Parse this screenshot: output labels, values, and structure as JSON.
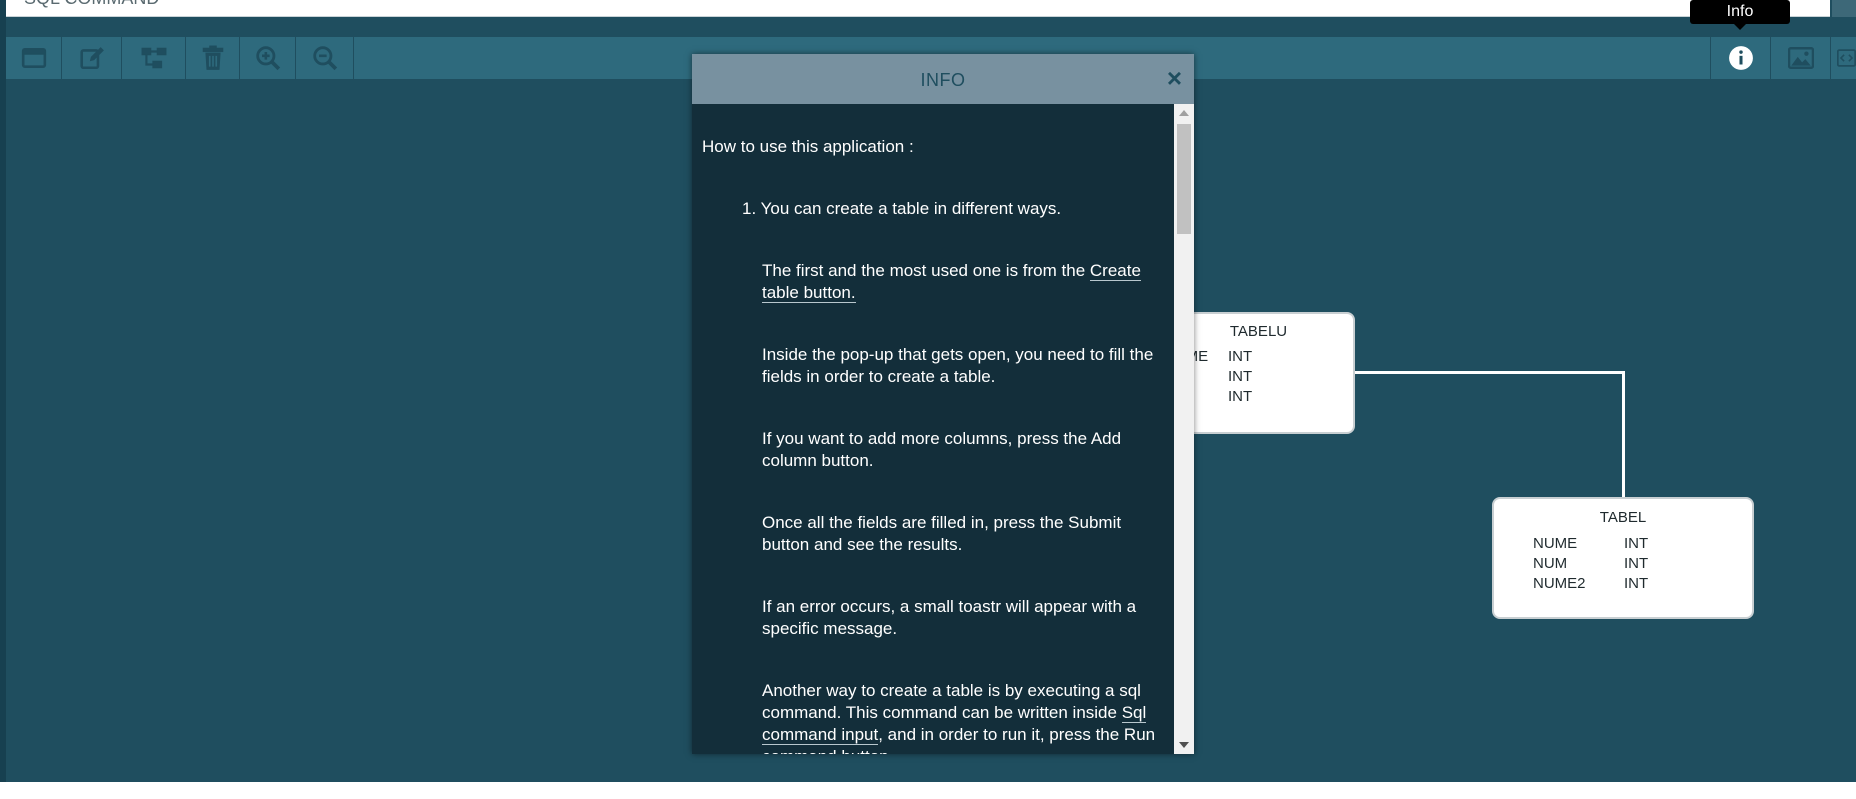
{
  "header": {
    "sql_input_text": "SQL COMMAND"
  },
  "toolbar": {
    "tooltip": "Info",
    "buttons_left": [
      "create-table-icon",
      "edit-icon",
      "diagram-icon",
      "trash-icon",
      "zoom-in-icon",
      "zoom-out-icon"
    ],
    "buttons_right": [
      "info-icon",
      "image-icon",
      "code-icon"
    ]
  },
  "colors": {
    "background": "#1f4e5f",
    "toolbar": "#2e6a7d",
    "modal_header": "#7891a0",
    "modal_body": "#132e3a"
  },
  "tables": [
    {
      "title": "TABELU",
      "columns": [
        {
          "name": "NUME",
          "type": "INT"
        },
        {
          "name": "",
          "type": "INT"
        },
        {
          "name": "",
          "type": "INT"
        }
      ]
    },
    {
      "title": "TABEL",
      "columns": [
        {
          "name": "NUME",
          "type": "INT"
        },
        {
          "name": "NUM",
          "type": "INT"
        },
        {
          "name": "NUME2",
          "type": "INT"
        }
      ]
    }
  ],
  "modal": {
    "title": "INFO",
    "close": "×",
    "intro": "How to use this application :",
    "item_1": "1. You can create a table in different ways.",
    "p1_text": "The first and the most used one is from the ",
    "p1_link": "Create table button.",
    "p2": "Inside the pop-up that gets open, you need to fill the fields in order to create a table.",
    "p3": "If you want to add more columns, press the Add column button.",
    "p4": "Once all the fields are filled in, press the Submit button and see the results.",
    "p5": "If an error occurs, a small toastr will appear with a specific message.",
    "p6_a": "Another way to create a table is by executing a sql command. This command can be written inside ",
    "p6_link": "Sql command input",
    "p6_b": ", and in order to run it, press the Run command button."
  }
}
